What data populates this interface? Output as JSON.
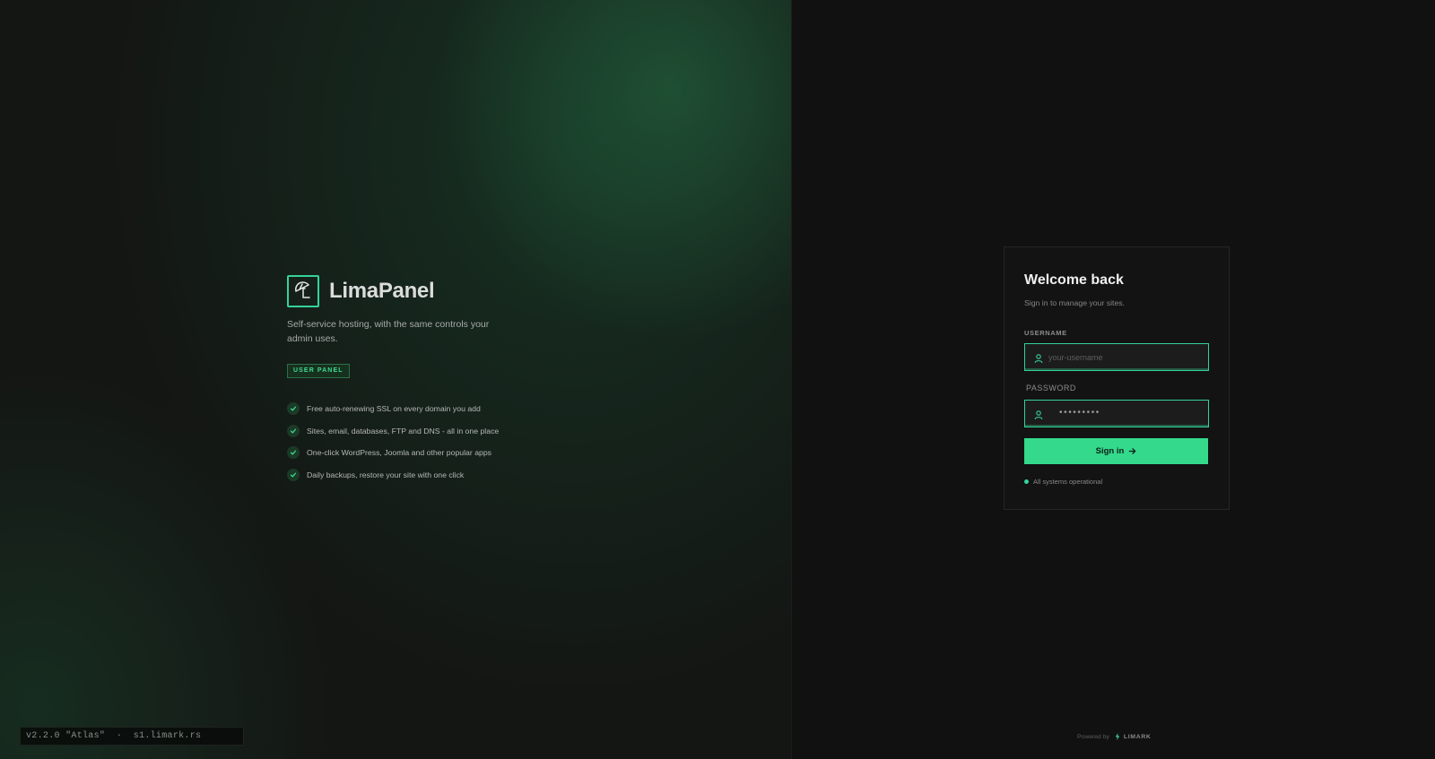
{
  "brand": {
    "name": "LimaPanel",
    "tagline": "Self-service hosting, with the same controls your admin uses.",
    "badge": "USER PANEL",
    "logo_icon": "umbrella-logo-icon"
  },
  "features": [
    "Free auto-renewing SSL on every domain you add",
    "Sites, email, databases, FTP and DNS - all in one place",
    "One-click WordPress, Joomla and other popular apps",
    "Daily backups, restore your site with one click"
  ],
  "version_info": "v2.2.0 \"Atlas\"  ·  s1.limark.rs",
  "login": {
    "title": "Welcome back",
    "subtitle": "Sign in to manage your sites.",
    "username_label": "USERNAME",
    "username_placeholder": "your-username",
    "username_value": "",
    "password_label": "PASSWORD",
    "password_masked": "•••••••••",
    "submit_label": "Sign in",
    "status_text": "All systems operational"
  },
  "footer": {
    "powered_by": "Powered by",
    "brand": "LIMARK"
  },
  "colors": {
    "accent": "#34d399",
    "button": "#34d98c",
    "background": "#121212"
  }
}
